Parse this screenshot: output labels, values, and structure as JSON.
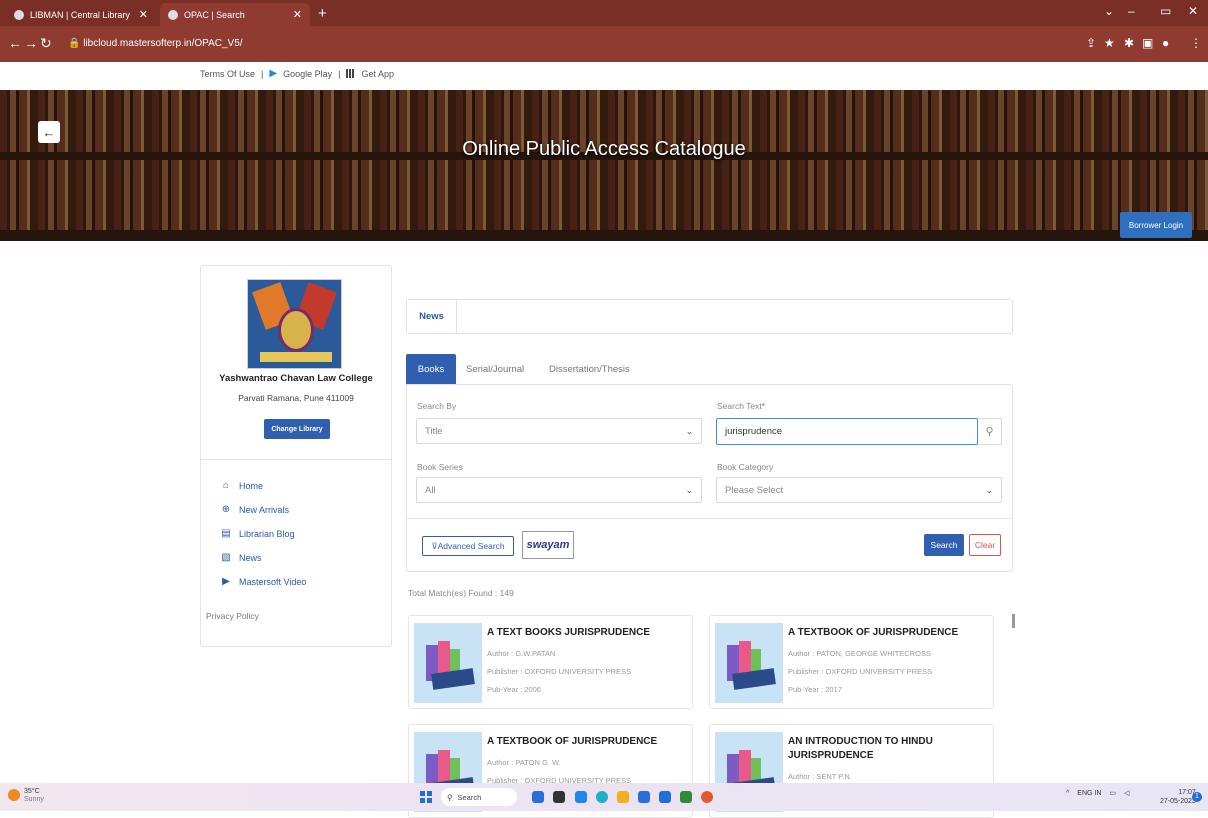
{
  "browser": {
    "tabs": [
      {
        "label": "LIBMAN | Central Library"
      },
      {
        "label": "OPAC | Search"
      }
    ],
    "url": "libcloud.mastersofterp.in/OPAC_V5/"
  },
  "topbar": {
    "terms": "Terms Of Use",
    "google_play": "Google Play",
    "get_app": "Get App",
    "sep": "|"
  },
  "banner": {
    "title": "Online Public Access Catalogue",
    "borrower_login": "Borrower Login"
  },
  "sidebar": {
    "college_name": "Yashwantrao Chavan Law College",
    "college_address": "Parvati Ramana, Pune 411009",
    "change_library": "Change Library",
    "items": [
      {
        "label": "Home",
        "icon": "home-icon"
      },
      {
        "label": "New Arrivals",
        "icon": "globe-icon"
      },
      {
        "label": "Librarian Blog",
        "icon": "blog-icon"
      },
      {
        "label": "News",
        "icon": "news-icon"
      },
      {
        "label": "Mastersoft Video",
        "icon": "video-icon"
      }
    ],
    "privacy": "Privacy Policy"
  },
  "news_tab": "News",
  "tabs": [
    {
      "label": "Books"
    },
    {
      "label": "Serial/Journal"
    },
    {
      "label": "Dissertation/Thesis"
    }
  ],
  "search": {
    "search_by_label": "Search By",
    "search_by_value": "Title",
    "search_text_label": "Search Text",
    "required_mark": "*",
    "search_text_value": "jurisprudence",
    "book_series_label": "Book Series",
    "book_series_value": "All",
    "book_category_label": "Book Category",
    "book_category_value": "Please Select",
    "advanced": "Advanced Search",
    "swayam": "swayam",
    "search_btn": "Search",
    "clear_btn": "Clear"
  },
  "total_matches": "Total Match(es) Found : 149",
  "results": [
    {
      "title": "A TEXT BOOKS JURISPRUDENCE",
      "author": "Author : G.W.PATAN",
      "publisher": "Publisher : OXFORD UNIVERSITY PRESS",
      "year": "Pub-Year : 2006"
    },
    {
      "title": "A TEXTBOOK OF JURISPRUDENCE",
      "author": "Author : PATON, GEORGE WHITECROSS",
      "publisher": "Publisher : OXFORD UNIVERSITY PRESS",
      "year": "Pub-Year : 2017"
    },
    {
      "title": "A TEXTBOOK OF JURISPRUDENCE",
      "author": "Author : PATON G. W.",
      "publisher": "Publisher : OXFORD UNIVERSITY PRESS",
      "year": ""
    },
    {
      "title": "AN INTRODUCTION TO HINDU JURISPRUDENCE",
      "author": "Author : SENT P.N.",
      "publisher": "",
      "year": ""
    }
  ],
  "taskbar": {
    "temp": "35°C",
    "weather": "Sunny",
    "search": "Search",
    "lang": "ENG",
    "region": "IN",
    "time": "17:07",
    "date": "27-05-2023",
    "notif": "1"
  },
  "colors": {
    "accent": "#2f5fae",
    "chrome": "#8f3b31",
    "clear": "#d9534f"
  }
}
